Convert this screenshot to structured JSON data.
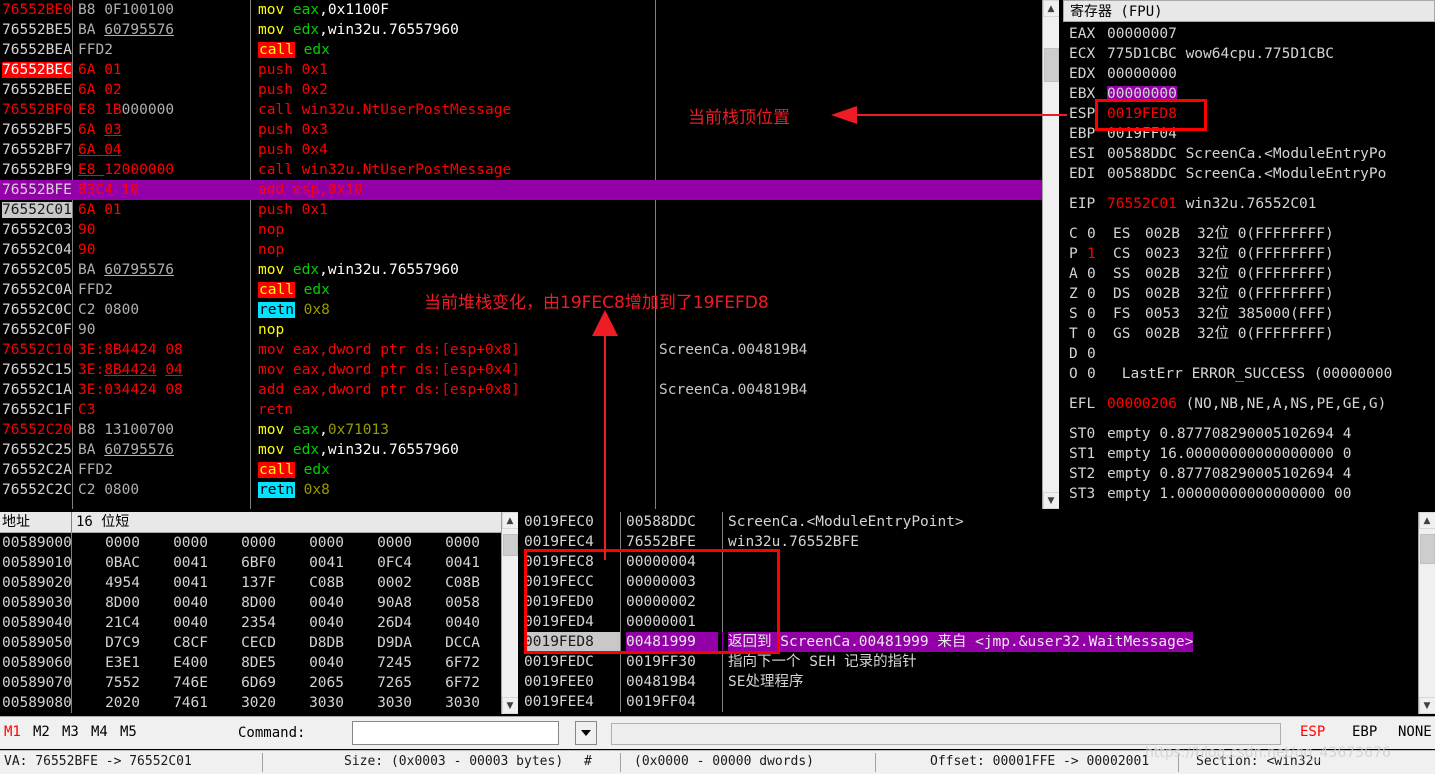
{
  "disassembly": {
    "rows": [
      {
        "addr": "76552BE0",
        "addr_style": "red",
        "bytes": [
          {
            "t": "B8 ",
            "c": "gray"
          },
          {
            "t": "0F100100",
            "c": "gray"
          }
        ],
        "insn": [
          {
            "t": "mov ",
            "c": "mn-y"
          },
          {
            "t": "eax",
            "c": "reg"
          },
          {
            "t": ",",
            "c": "wh"
          },
          {
            "t": "0x1100F",
            "c": "wh"
          }
        ],
        "comment": ""
      },
      {
        "addr": "76552BE5",
        "addr_style": "white",
        "bytes": [
          {
            "t": "BA ",
            "c": "gray"
          },
          {
            "t": "60795576",
            "c": "gray-ul"
          }
        ],
        "insn": [
          {
            "t": "mov ",
            "c": "mn-y"
          },
          {
            "t": "edx",
            "c": "reg"
          },
          {
            "t": ",",
            "c": "wh"
          },
          {
            "t": "win32u.76557960",
            "c": "wh"
          }
        ],
        "comment": ""
      },
      {
        "addr": "76552BEA",
        "addr_style": "white",
        "bytes": [
          {
            "t": "FFD2",
            "c": "gray"
          }
        ],
        "insn": [
          {
            "t": "call",
            "c": "call"
          },
          {
            "t": " ",
            "c": "wh"
          },
          {
            "t": "edx",
            "c": "reg"
          }
        ],
        "comment": ""
      },
      {
        "addr": "76552BEC",
        "addr_style": "bp",
        "bytes": [
          {
            "t": "6A ",
            "c": "red"
          },
          {
            "t": "01",
            "c": "red"
          }
        ],
        "insn": [
          {
            "t": "push ",
            "c": "mn-r"
          },
          {
            "t": "0x1",
            "c": "mn-r"
          }
        ],
        "comment": ""
      },
      {
        "addr": "76552BEE",
        "addr_style": "white",
        "bytes": [
          {
            "t": "6A ",
            "c": "red"
          },
          {
            "t": "02",
            "c": "red"
          }
        ],
        "insn": [
          {
            "t": "push ",
            "c": "mn-r"
          },
          {
            "t": "0x2",
            "c": "mn-r"
          }
        ],
        "comment": ""
      },
      {
        "addr": "76552BF0",
        "addr_style": "red",
        "bytes": [
          {
            "t": "E8 ",
            "c": "red"
          },
          {
            "t": "1B",
            "c": "red"
          },
          {
            "t": "000000",
            "c": "gray"
          }
        ],
        "insn": [
          {
            "t": "call ",
            "c": "mn-r"
          },
          {
            "t": "win32u.NtUserPostMessage",
            "c": "mn-r"
          }
        ],
        "comment": ""
      },
      {
        "addr": "76552BF5",
        "addr_style": "white",
        "bytes": [
          {
            "t": "6A ",
            "c": "red"
          },
          {
            "t": "03",
            "c": "red-ul"
          }
        ],
        "insn": [
          {
            "t": "push ",
            "c": "mn-r"
          },
          {
            "t": "0x3",
            "c": "mn-r"
          }
        ],
        "comment": ""
      },
      {
        "addr": "76552BF7",
        "addr_style": "white",
        "bytes": [
          {
            "t": "6A ",
            "c": "red-ul"
          },
          {
            "t": "04",
            "c": "red-ul"
          }
        ],
        "insn": [
          {
            "t": "push ",
            "c": "mn-r"
          },
          {
            "t": "0x4",
            "c": "mn-r"
          }
        ],
        "comment": ""
      },
      {
        "addr": "76552BF9",
        "addr_style": "white",
        "bytes": [
          {
            "t": "E8 ",
            "c": "red-ul"
          },
          {
            "t": "12000000",
            "c": "red"
          }
        ],
        "insn": [
          {
            "t": "call ",
            "c": "mn-r"
          },
          {
            "t": "win32u.NtUserPostMessage",
            "c": "mn-r"
          }
        ],
        "comment": ""
      },
      {
        "addr": "76552BFE",
        "addr_style": "white",
        "highlight": "purple",
        "bytes": [
          {
            "t": "83C4 10",
            "c": "plain"
          }
        ],
        "insn": [
          {
            "t": "add esp,0x10",
            "c": "plain"
          }
        ],
        "comment": ""
      },
      {
        "addr": "76552C01",
        "addr_style": "sel",
        "bytes": [
          {
            "t": "6A ",
            "c": "red"
          },
          {
            "t": "01",
            "c": "red"
          }
        ],
        "insn": [
          {
            "t": "push ",
            "c": "mn-r"
          },
          {
            "t": "0x1",
            "c": "mn-r"
          }
        ],
        "comment": ""
      },
      {
        "addr": "76552C03",
        "addr_style": "white",
        "bytes": [
          {
            "t": "90",
            "c": "red"
          }
        ],
        "insn": [
          {
            "t": "nop",
            "c": "mn-r"
          }
        ],
        "comment": ""
      },
      {
        "addr": "76552C04",
        "addr_style": "white",
        "bytes": [
          {
            "t": "90",
            "c": "red"
          }
        ],
        "insn": [
          {
            "t": "nop",
            "c": "mn-r"
          }
        ],
        "comment": ""
      },
      {
        "addr": "76552C05",
        "addr_style": "white",
        "bytes": [
          {
            "t": "BA ",
            "c": "gray"
          },
          {
            "t": "60795576",
            "c": "gray-ul"
          }
        ],
        "insn": [
          {
            "t": "mov ",
            "c": "mn-y"
          },
          {
            "t": "edx",
            "c": "reg"
          },
          {
            "t": ",",
            "c": "wh"
          },
          {
            "t": "win32u.76557960",
            "c": "wh"
          }
        ],
        "comment": ""
      },
      {
        "addr": "76552C0A",
        "addr_style": "white",
        "bytes": [
          {
            "t": "FFD2",
            "c": "gray"
          }
        ],
        "insn": [
          {
            "t": "call",
            "c": "call"
          },
          {
            "t": " ",
            "c": "wh"
          },
          {
            "t": "edx",
            "c": "reg"
          }
        ],
        "comment": ""
      },
      {
        "addr": "76552C0C",
        "addr_style": "white",
        "bytes": [
          {
            "t": "C2 0800",
            "c": "gray"
          }
        ],
        "insn": [
          {
            "t": "retn",
            "c": "retn"
          },
          {
            "t": " ",
            "c": "wh"
          },
          {
            "t": "0x8",
            "c": "olive"
          }
        ],
        "comment": ""
      },
      {
        "addr": "76552C0F",
        "addr_style": "white",
        "bytes": [
          {
            "t": "90",
            "c": "gray"
          }
        ],
        "insn": [
          {
            "t": "nop",
            "c": "mn-y"
          }
        ],
        "comment": ""
      },
      {
        "addr": "76552C10",
        "addr_style": "red",
        "bytes": [
          {
            "t": "3E:",
            "c": "red"
          },
          {
            "t": "8B4424 ",
            "c": "red"
          },
          {
            "t": "08",
            "c": "red"
          }
        ],
        "insn": [
          {
            "t": "mov ",
            "c": "mn-r"
          },
          {
            "t": "eax,dword ptr ds:[esp+0x8]",
            "c": "mn-r"
          }
        ],
        "comment": "ScreenCa.004819B4"
      },
      {
        "addr": "76552C15",
        "addr_style": "white",
        "bytes": [
          {
            "t": "3E:",
            "c": "red"
          },
          {
            "t": "8B4424",
            "c": "red-ul"
          },
          {
            "t": " ",
            "c": "red"
          },
          {
            "t": "04",
            "c": "red-ul"
          }
        ],
        "insn": [
          {
            "t": "mov ",
            "c": "mn-r"
          },
          {
            "t": "eax,dword ptr ds:[esp+0x4]",
            "c": "mn-r"
          }
        ],
        "comment": ""
      },
      {
        "addr": "76552C1A",
        "addr_style": "white",
        "bytes": [
          {
            "t": "3E:",
            "c": "red"
          },
          {
            "t": "034424 ",
            "c": "red"
          },
          {
            "t": "08",
            "c": "red"
          }
        ],
        "insn": [
          {
            "t": "add ",
            "c": "mn-r"
          },
          {
            "t": "eax,dword ptr ds:[esp+0x8]",
            "c": "mn-r"
          }
        ],
        "comment": "ScreenCa.004819B4"
      },
      {
        "addr": "76552C1F",
        "addr_style": "white",
        "bytes": [
          {
            "t": "C3",
            "c": "red"
          }
        ],
        "insn": [
          {
            "t": "retn",
            "c": "mn-r"
          }
        ],
        "comment": ""
      },
      {
        "addr": "76552C20",
        "addr_style": "red",
        "bytes": [
          {
            "t": "B8 ",
            "c": "gray"
          },
          {
            "t": "13100700",
            "c": "gray"
          }
        ],
        "insn": [
          {
            "t": "mov ",
            "c": "mn-y"
          },
          {
            "t": "eax",
            "c": "reg"
          },
          {
            "t": ",",
            "c": "wh"
          },
          {
            "t": "0x71013",
            "c": "olive"
          }
        ],
        "comment": ""
      },
      {
        "addr": "76552C25",
        "addr_style": "white",
        "bytes": [
          {
            "t": "BA ",
            "c": "gray"
          },
          {
            "t": "60795576",
            "c": "gray-ul"
          }
        ],
        "insn": [
          {
            "t": "mov ",
            "c": "mn-y"
          },
          {
            "t": "edx",
            "c": "reg"
          },
          {
            "t": ",",
            "c": "wh"
          },
          {
            "t": "win32u.76557960",
            "c": "wh"
          }
        ],
        "comment": ""
      },
      {
        "addr": "76552C2A",
        "addr_style": "white",
        "bytes": [
          {
            "t": "FFD2",
            "c": "gray"
          }
        ],
        "insn": [
          {
            "t": "call",
            "c": "call"
          },
          {
            "t": " ",
            "c": "wh"
          },
          {
            "t": "edx",
            "c": "reg"
          }
        ],
        "comment": ""
      },
      {
        "addr": "76552C2C",
        "addr_style": "white",
        "bytes": [
          {
            "t": "C2 0800",
            "c": "gray"
          }
        ],
        "insn": [
          {
            "t": "retn",
            "c": "retn"
          },
          {
            "t": " ",
            "c": "wh"
          },
          {
            "t": "0x8",
            "c": "olive"
          }
        ],
        "comment": ""
      }
    ]
  },
  "registers": {
    "title": "寄存器 (FPU)",
    "general": [
      {
        "name": "EAX",
        "value": "00000007",
        "comment": "",
        "style": "plain"
      },
      {
        "name": "ECX",
        "value": "775D1CBC",
        "comment": "wow64cpu.775D1CBC",
        "style": "plain"
      },
      {
        "name": "EDX",
        "value": "00000000",
        "comment": "",
        "style": "plain"
      },
      {
        "name": "EBX",
        "value": "00000000",
        "comment": "",
        "style": "purple"
      },
      {
        "name": "ESP",
        "value": "0019FED8",
        "comment": "",
        "style": "red"
      },
      {
        "name": "EBP",
        "value": "0019FF04",
        "comment": "",
        "style": "plain"
      },
      {
        "name": "ESI",
        "value": "00588DDC",
        "comment": "ScreenCa.<ModuleEntryPo",
        "style": "plain"
      },
      {
        "name": "EDI",
        "value": "00588DDC",
        "comment": "ScreenCa.<ModuleEntryPo",
        "style": "plain"
      }
    ],
    "eip": {
      "name": "EIP",
      "value": "76552C01",
      "comment": "win32u.76552C01"
    },
    "flags": [
      {
        "f": "C",
        "v": "0",
        "seg": "ES",
        "segv": "002B",
        "bits": "32位",
        "base": "0(FFFFFFFF)"
      },
      {
        "f": "P",
        "v": "1",
        "seg": "CS",
        "segv": "0023",
        "bits": "32位",
        "base": "0(FFFFFFFF)"
      },
      {
        "f": "A",
        "v": "0",
        "seg": "SS",
        "segv": "002B",
        "bits": "32位",
        "base": "0(FFFFFFFF)"
      },
      {
        "f": "Z",
        "v": "0",
        "seg": "DS",
        "segv": "002B",
        "bits": "32位",
        "base": "0(FFFFFFFF)"
      },
      {
        "f": "S",
        "v": "0",
        "seg": "FS",
        "segv": "0053",
        "bits": "32位",
        "base": "385000(FFF)"
      },
      {
        "f": "T",
        "v": "0",
        "seg": "GS",
        "segv": "002B",
        "bits": "32位",
        "base": "0(FFFFFFFF)"
      },
      {
        "f": "D",
        "v": "0",
        "seg": "",
        "segv": "",
        "bits": "",
        "base": ""
      },
      {
        "f": "O",
        "v": "0",
        "seg": "",
        "segv": "",
        "bits": "",
        "base": "",
        "lasterr": "LastErr ERROR_SUCCESS (00000000"
      }
    ],
    "efl": {
      "name": "EFL",
      "value": "00000206",
      "decode": "(NO,NB,NE,A,NS,PE,GE,G)"
    },
    "fpu": [
      {
        "name": "ST0",
        "state": "empty",
        "value": "0.877708290005102694 4"
      },
      {
        "name": "ST1",
        "state": "empty",
        "value": "16.00000000000000000 0"
      },
      {
        "name": "ST2",
        "state": "empty",
        "value": "0.877708290005102694 4"
      },
      {
        "name": "ST3",
        "state": "empty",
        "value": "1.00000000000000000 00"
      }
    ]
  },
  "dump": {
    "header": {
      "address_col": "地址",
      "data_col": "16 位短"
    },
    "rows": [
      {
        "addr": "00589000",
        "cells": [
          "0000",
          "0000",
          "0000",
          "0000",
          "0000",
          "0000"
        ]
      },
      {
        "addr": "00589010",
        "cells": [
          "0BAC",
          "0041",
          "6BF0",
          "0041",
          "0FC4",
          "0041"
        ]
      },
      {
        "addr": "00589020",
        "cells": [
          "4954",
          "0041",
          "137F",
          "C08B",
          "0002",
          "C08B"
        ]
      },
      {
        "addr": "00589030",
        "cells": [
          "8D00",
          "0040",
          "8D00",
          "0040",
          "90A8",
          "0058"
        ]
      },
      {
        "addr": "00589040",
        "cells": [
          "21C4",
          "0040",
          "2354",
          "0040",
          "26D4",
          "0040"
        ]
      },
      {
        "addr": "00589050",
        "cells": [
          "D7C9",
          "C8CF",
          "CECD",
          "D8DB",
          "D9DA",
          "DCCA"
        ]
      },
      {
        "addr": "00589060",
        "cells": [
          "E3E1",
          "E400",
          "8DE5",
          "0040",
          "7245",
          "6F72"
        ]
      },
      {
        "addr": "00589070",
        "cells": [
          "7552",
          "746E",
          "6D69",
          "2065",
          "7265",
          "6F72"
        ]
      },
      {
        "addr": "00589080",
        "cells": [
          "2020",
          "7461",
          "3020",
          "3030",
          "3030",
          "3030"
        ]
      }
    ]
  },
  "stack": {
    "rows": [
      {
        "addr": "0019FEC0",
        "value": "00588DDC",
        "comment": "ScreenCa.<ModuleEntryPoint>",
        "selected": false
      },
      {
        "addr": "0019FEC4",
        "value": "76552BFE",
        "comment": "win32u.76552BFE",
        "selected": false
      },
      {
        "addr": "0019FEC8",
        "value": "00000004",
        "comment": "",
        "selected": false
      },
      {
        "addr": "0019FECC",
        "value": "00000003",
        "comment": "",
        "selected": false
      },
      {
        "addr": "0019FED0",
        "value": "00000002",
        "comment": "",
        "selected": false
      },
      {
        "addr": "0019FED4",
        "value": "00000001",
        "comment": "",
        "selected": false
      },
      {
        "addr": "0019FED8",
        "value": "00481999",
        "comment": "返回到 ScreenCa.00481999 来自 <jmp.&user32.WaitMessage>",
        "selected": true
      },
      {
        "addr": "0019FEDC",
        "value": "0019FF30",
        "comment": "指向下一个 SEH 记录的指针",
        "selected": false
      },
      {
        "addr": "0019FEE0",
        "value": "004819B4",
        "comment": "SE处理程序",
        "selected": false
      },
      {
        "addr": "0019FEE4",
        "value": "0019FF04",
        "comment": "",
        "selected": false
      }
    ]
  },
  "annotations": {
    "stack_top": "当前栈顶位置",
    "stack_change": "当前堆栈变化，由19FEC8增加到了19FEFD8"
  },
  "bottom_bar": {
    "memory_buttons": [
      "M1",
      "M2",
      "M3",
      "M4",
      "M5"
    ],
    "active_memory_button": "M1",
    "command_label": "Command:",
    "command_value": "",
    "command_placeholder": "",
    "second_input_value": "",
    "right_buttons": [
      "ESP",
      "EBP",
      "NONE"
    ]
  },
  "status_bar": {
    "va": "VA: 76552BFE -> 76552C01",
    "size": "Size: (0x0003 - 00003 bytes)",
    "hash": "#",
    "dwords": "(0x0000 - 00000 dwords)",
    "offset": "Offset: 00001FFE -> 00002001",
    "section": "Section: <win32u"
  },
  "watermark": "https://blog.csdn.net/qq_43673676",
  "colors": {
    "accent_red": "#ff0000",
    "highlight_purple": "#9400a8",
    "annotation_red": "#ee1c24",
    "call_bg": "#ff0000",
    "retn_bg": "#00e5ff"
  }
}
